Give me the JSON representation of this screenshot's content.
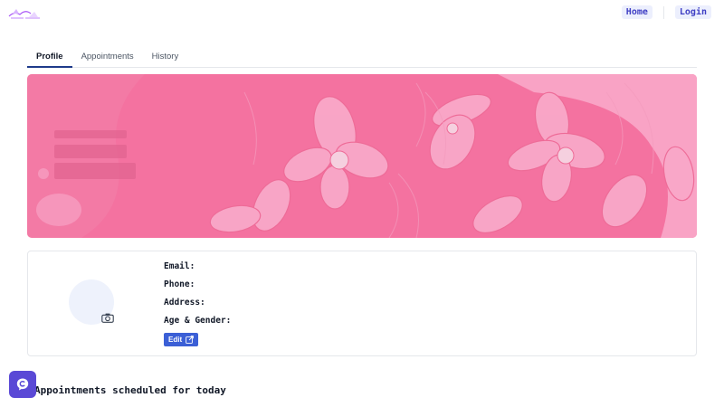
{
  "nav": {
    "home_label": "Home",
    "login_label": "Login"
  },
  "tabs": [
    {
      "label": "Profile",
      "active": true
    },
    {
      "label": "Appointments",
      "active": false
    },
    {
      "label": "History",
      "active": false
    }
  ],
  "profile": {
    "email_label": "Email:",
    "phone_label": "Phone:",
    "address_label": "Address:",
    "age_gender_label": "Age & Gender:",
    "edit_label": "Edit"
  },
  "appointments": {
    "section_title": "Appointments scheduled for today"
  },
  "icons": {
    "logo": "books-logo-icon",
    "camera": "camera-icon",
    "edit": "external-edit-icon",
    "chat": "chat-support-icon"
  },
  "colors": {
    "banner_pink": "#f472a0",
    "accent_blue": "#3b5fd6",
    "nav_text": "#3f3fc4",
    "fab": "#5a49d6"
  }
}
